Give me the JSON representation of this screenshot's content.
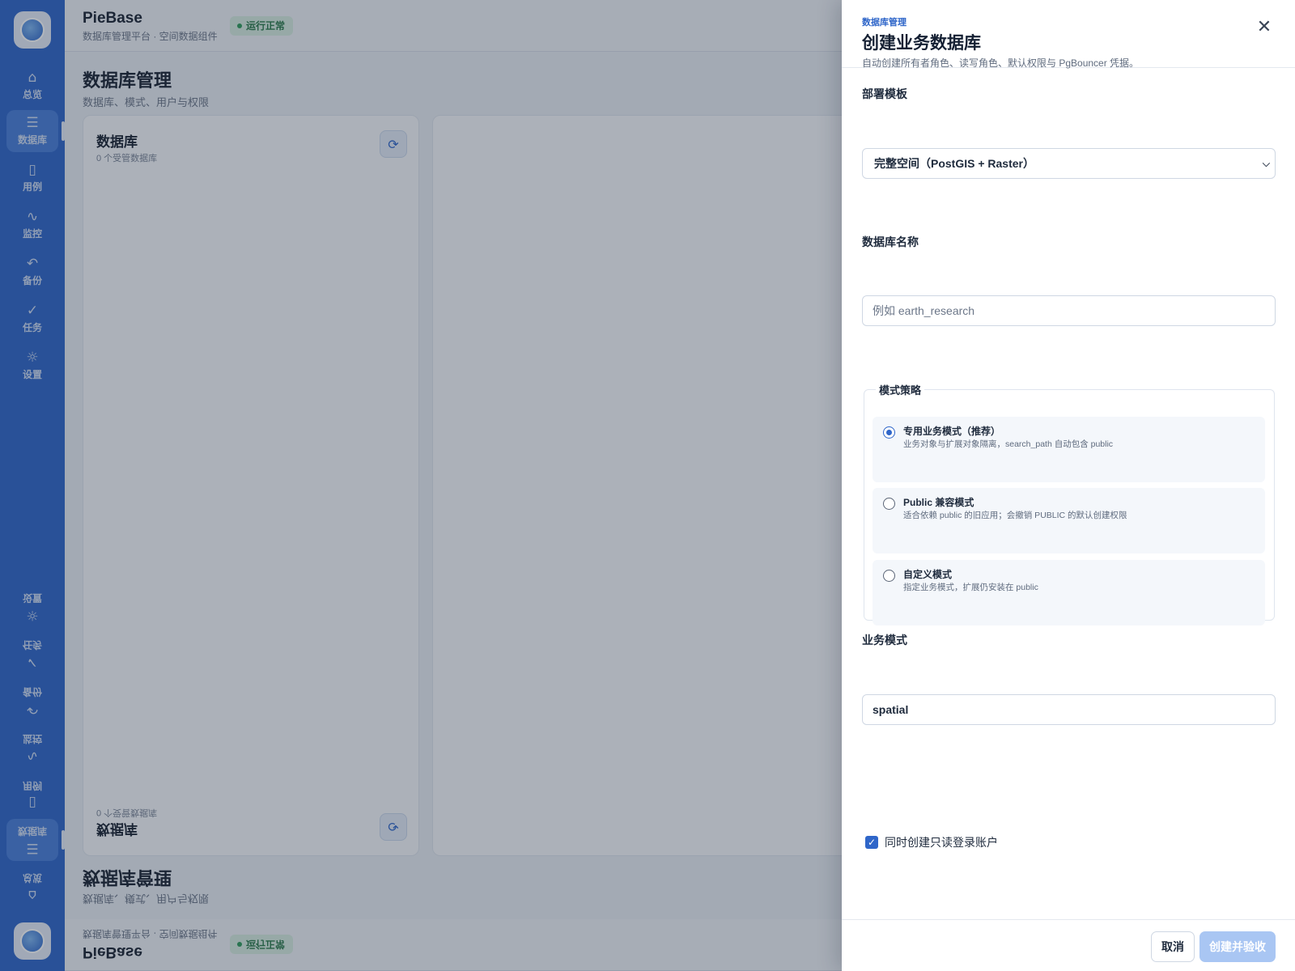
{
  "app": {
    "name": "PieBase",
    "subtitle": "数据库管理平台 · 空间数据组件",
    "status": "运行正常",
    "page_title": "数据库管理",
    "page_subtitle": "数据库、模式、用户与权限"
  },
  "sidebar": {
    "items": [
      {
        "label": "总览",
        "icon": "home-icon"
      },
      {
        "label": "数据库",
        "icon": "database-icon",
        "active": true
      },
      {
        "label": "用例",
        "icon": "clipboard-icon"
      },
      {
        "label": "监控",
        "icon": "activity-icon"
      },
      {
        "label": "备份",
        "icon": "undo-icon"
      },
      {
        "label": "任务",
        "icon": "check-icon"
      },
      {
        "label": "设置",
        "icon": "gear-icon"
      }
    ]
  },
  "database_card": {
    "title": "数据库",
    "count_text": "0 个受管数据库"
  },
  "drawer": {
    "eyebrow": "数据库管理",
    "title": "创建业务数据库",
    "description": "自动创建所有者角色、读写角色、默认权限与 PgBouncer 凭据。",
    "template_label": "部署模板",
    "template_value": "完整空间（PostGIS + Raster）",
    "name_label": "数据库名称",
    "name_placeholder": "例如 earth_research",
    "name_value": "",
    "strategy_label": "模式策略",
    "strategy_options": [
      {
        "title": "专用业务模式（推荐）",
        "desc": "业务对象与扩展对象隔离，search_path 自动包含 public",
        "selected": true
      },
      {
        "title": "Public 兼容模式",
        "desc": "适合依赖 public 的旧应用；会撤销 PUBLIC 的默认创建权限",
        "selected": false
      },
      {
        "title": "自定义模式",
        "desc": "指定业务模式，扩展仍安装在 public",
        "selected": false
      }
    ],
    "schema_label": "业务模式",
    "schema_value": "spatial",
    "readonly_checkbox_label": "同时创建只读登录账户",
    "readonly_checked": true,
    "cancel_label": "取消",
    "submit_label": "创建并验收"
  },
  "colors": {
    "brand": "#2f66c9",
    "status_ok": "#2f9c5b",
    "submit_disabled": "#a9c6f3"
  }
}
